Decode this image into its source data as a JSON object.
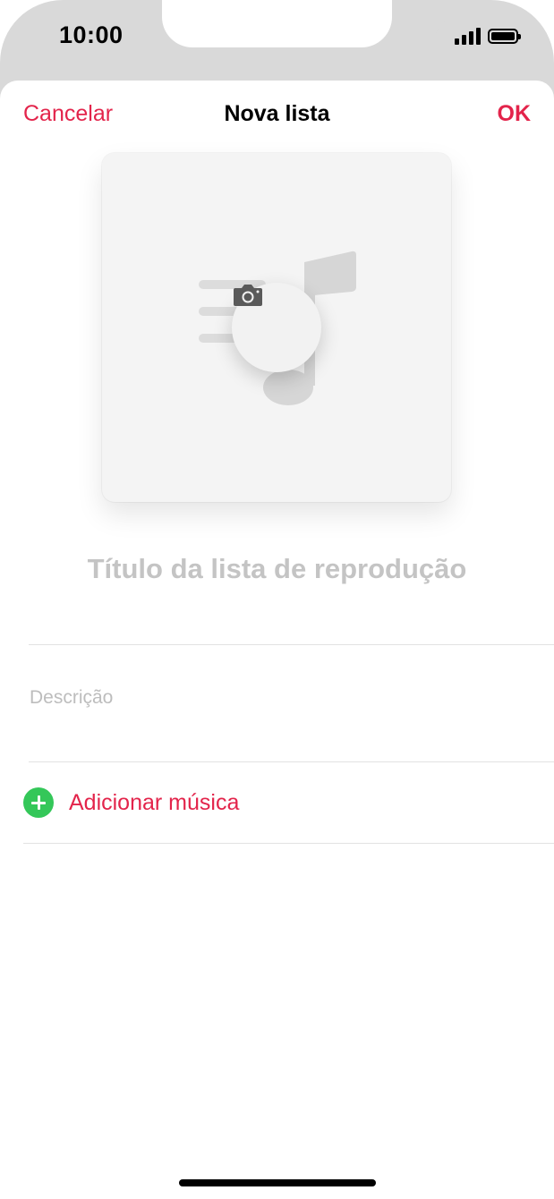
{
  "status_bar": {
    "time": "10:00"
  },
  "nav": {
    "cancel_label": "Cancelar",
    "title": "Nova lista",
    "ok_label": "OK"
  },
  "artwork": {
    "icon": "music-note-placeholder",
    "action_icon": "camera-icon"
  },
  "form": {
    "title_placeholder": "Título da lista de reprodução",
    "description_placeholder": "Descrição"
  },
  "add_music": {
    "label": "Adicionar música",
    "icon": "plus-circle-icon"
  },
  "colors": {
    "accent": "#e3244b",
    "add_icon": "#34c759",
    "placeholder": "#c4c4c4"
  }
}
